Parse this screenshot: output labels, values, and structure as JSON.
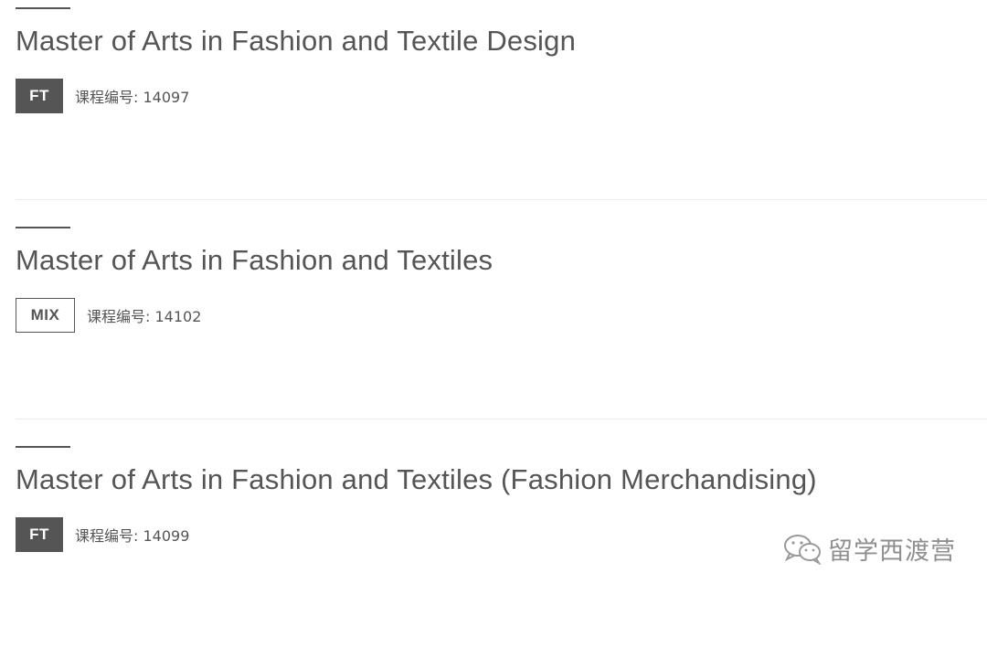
{
  "programs": [
    {
      "title": "Master of Arts in Fashion and Textile Design",
      "badge": "FT",
      "course_code": "课程编号: 14097"
    },
    {
      "title": "Master of Arts in Fashion and Textiles",
      "badge": "MIX",
      "course_code": "课程编号: 14102"
    },
    {
      "title": "Master of Arts in Fashion and Textiles (Fashion Merchandising)",
      "badge": "FT",
      "course_code": "课程编号: 14099"
    }
  ],
  "watermark": {
    "icon": "wechat-icon",
    "text": "留学西渡营"
  },
  "colors": {
    "text": "#555555",
    "badge_fill": "#555555",
    "divider": "#ececec",
    "watermark": "#8f8f8f"
  }
}
